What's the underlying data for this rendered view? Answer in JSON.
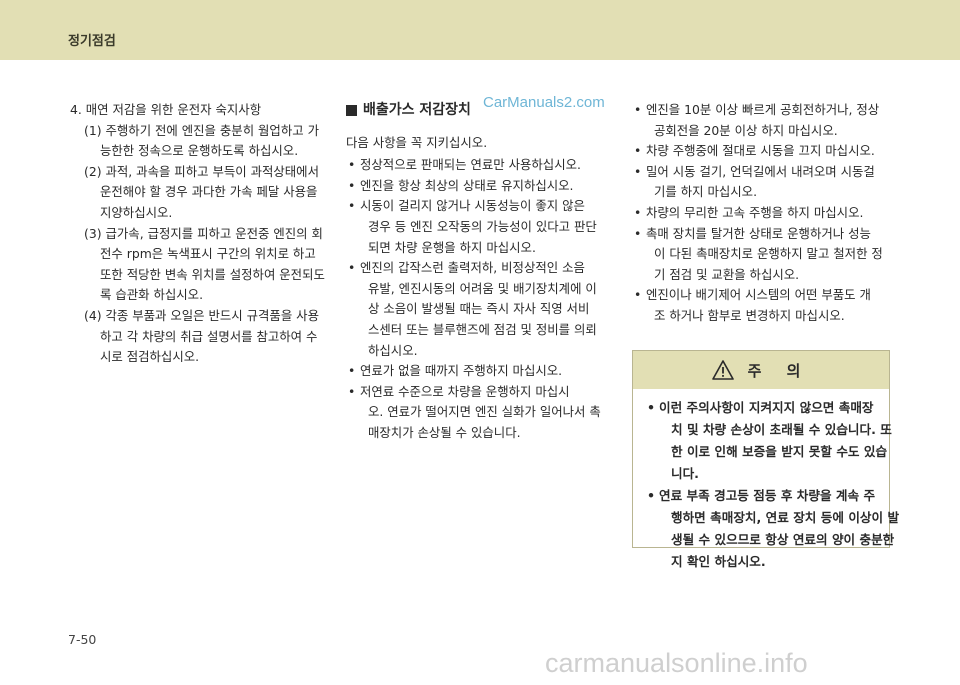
{
  "header": {
    "title": "정기점검"
  },
  "col1": {
    "heading": "4. 매연 저감을 위한 운전자 숙지사항",
    "items": [
      {
        "lines": [
          "(1) 주행하기 전에 엔진을 충분히 웜업하고 가",
          "능한한 정속으로 운행하도록 하십시오."
        ]
      },
      {
        "lines": [
          "(2) 과적, 과속을 피하고 부득이 과적상태에서",
          "운전해야 할 경우 과다한 가속 페달 사용을",
          "지양하십시오."
        ]
      },
      {
        "lines": [
          "(3) 급가속, 급정지를 피하고 운전중 엔진의 회",
          "전수 rpm은 녹색표시 구간의 위치로 하고",
          "또한 적당한 변속 위치를 설정하여 운전되도",
          "록 습관화 하십시오."
        ]
      },
      {
        "lines": [
          "(4) 각종 부품과 오일은 반드시 규격품을 사용",
          "하고 각 차량의 취급 설명서를 참고하여 수",
          "시로 점검하십시오."
        ]
      }
    ]
  },
  "col2": {
    "title": "배출가스 저감장치",
    "intro": "다음 사항을 꼭 지키십시오.",
    "bullets": [
      {
        "lines": [
          "정상적으로 판매되는 연료만 사용하십시오."
        ]
      },
      {
        "lines": [
          "엔진을 항상 최상의 상태로 유지하십시오."
        ]
      },
      {
        "lines": [
          "시동이 걸리지 않거나 시동성능이 좋지 않은",
          "경우 등 엔진 오작동의 가능성이 있다고 판단",
          "되면 차량 운행을 하지 마십시오."
        ]
      },
      {
        "lines": [
          "엔진의 갑작스런 출력저하, 비정상적인 소음",
          "유발, 엔진시동의 어려움 및 배기장치계에 이",
          "상 소음이 발생될 때는 즉시 자사 직영 서비",
          "스센터 또는 블루핸즈에 점검 및 정비를 의뢰",
          "하십시오."
        ]
      },
      {
        "lines": [
          "연료가 없을 때까지 주행하지 마십시오."
        ]
      },
      {
        "lines": [
          "저연료 수준으로 차량을 운행하지 마십시",
          "오. 연료가 떨어지면 엔진 실화가 일어나서 촉",
          "매장치가 손상될 수 있습니다."
        ]
      }
    ]
  },
  "col3": {
    "bullets": [
      {
        "lines": [
          "엔진을 10분 이상 빠르게 공회전하거나, 정상",
          "공회전을 20분 이상 하지 마십시오."
        ]
      },
      {
        "lines": [
          "차량 주행중에 절대로 시동을 끄지 마십시오."
        ]
      },
      {
        "lines": [
          "밀어 시동 걸기, 언덕길에서 내려오며 시동걸",
          "기를 하지 마십시오."
        ]
      },
      {
        "lines": [
          "차량의 무리한 고속 주행을 하지 마십시오."
        ]
      },
      {
        "lines": [
          "촉매 장치를 탈거한 상태로 운행하거나 성능",
          "이 다된 촉매장치로 운행하지 말고 철저한 정",
          "기 점검 및 교환을 하십시오."
        ]
      },
      {
        "lines": [
          "엔진이나 배기제어 시스템의 어떤 부품도 개",
          "조 하거나 함부로 변경하지 마십시오."
        ]
      }
    ]
  },
  "caution": {
    "title": "주 의",
    "icon": "warning-triangle-icon",
    "bullets": [
      {
        "lines": [
          "이런 주의사항이 지켜지지 않으면 촉매장",
          "치 및 차량 손상이 초래될 수 있습니다. 또",
          "한 이로 인해 보증을 받지 못할 수도 있습",
          "니다."
        ]
      },
      {
        "lines": [
          "연료 부족 경고등 점등 후 차량을 계속 주",
          "행하면 촉매장치, 연료 장치 등에 이상이 발",
          "생될 수 있으므로 항상 연료의 양이 충분한",
          "지 확인 하십시오."
        ]
      }
    ]
  },
  "page_number": "7-50",
  "watermark": "CarManuals2.com",
  "footer_watermark": "carmanualsonline.info",
  "colors": {
    "header_band": "#e2dfb4",
    "watermark": "#6fb6d6"
  }
}
